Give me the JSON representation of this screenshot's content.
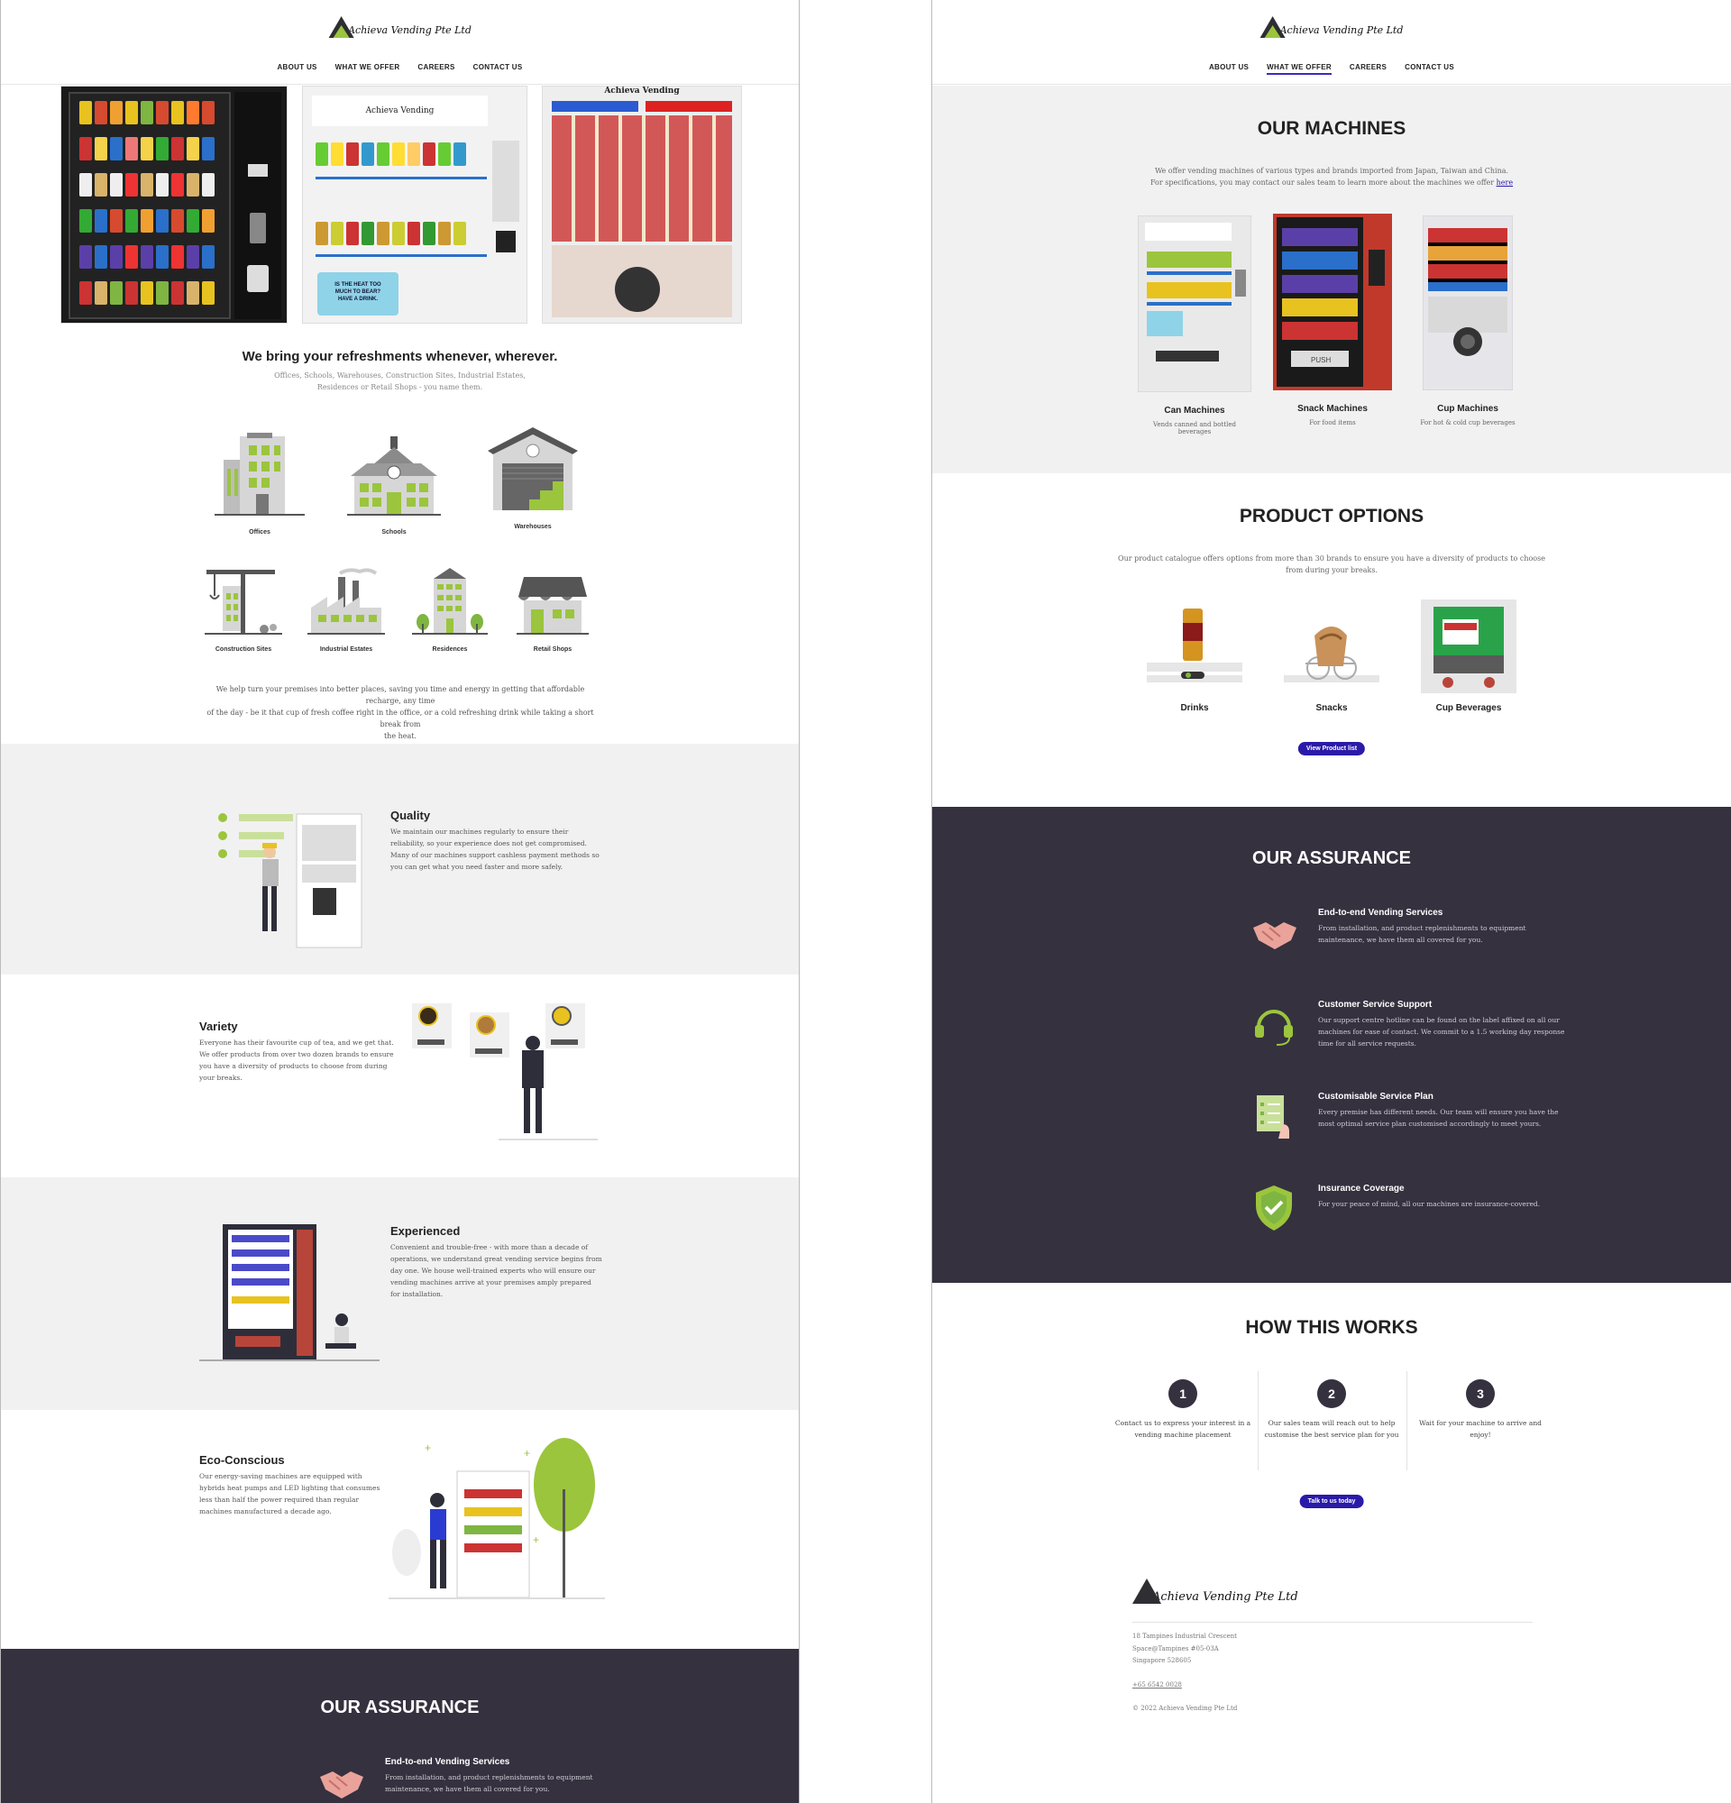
{
  "brand": {
    "logo_text": "Achieva Vending Pte Ltd",
    "accent": "#9bc53d",
    "dark": "#35313f",
    "button": "#2a1aa8"
  },
  "nav": {
    "about": "ABOUT US",
    "offer": "WHAT WE OFFER",
    "careers": "CAREERS",
    "contact": "CONTACT US"
  },
  "home": {
    "hero_can_label": "Achieva Vending",
    "hero_cup_label": "Achieva Vending",
    "hero_can_sign": "IS THE HEAT TOO MUCH TO BEAR? HAVE A DRINK.",
    "tagline": "We bring your refreshments whenever, wherever.",
    "tagline_sub_1": "Offices, Schools, Warehouses, Construction Sites, Industrial Estates,",
    "tagline_sub_2": "Residences or Retail Shops - you name them.",
    "locations": [
      "Offices",
      "Schools",
      "Warehouses",
      "Construction Sites",
      "Industrial Estates",
      "Residences",
      "Retail Shops"
    ],
    "intro_1": "We help turn your premises into better places, saving you time and energy in getting that affordable recharge, any time",
    "intro_2": "of the day - be it that cup of fresh coffee right in the office, or a cold refreshing drink while taking a short break from",
    "intro_3": "the heat.",
    "features": [
      {
        "title": "Quality",
        "text": "We maintain our machines regularly to ensure their reliability, so your experience does not get compromised. Many of our machines support cashless payment methods so you can get what you need faster and more safely."
      },
      {
        "title": "Variety",
        "text": "Everyone has their favourite cup of tea, and we get that. We offer products from over two dozen brands to ensure you have a diversity of products to choose from during your breaks."
      },
      {
        "title": "Experienced",
        "text": "Convenient and trouble-free - with more than a decade of operations, we understand great vending service begins from day one. We house well-trained experts who will ensure our vending machines arrive at your premises amply prepared for installation."
      },
      {
        "title": "Eco-Conscious",
        "text": "Our energy-saving machines are equipped with hybrids heat pumps and LED lighting that consumes less than half the power required than regular machines manufactured a decade ago."
      }
    ],
    "assurance_title": "OUR ASSURANCE",
    "assurance_first_title": "End-to-end Vending Services",
    "assurance_first_text": "From installation, and product replenishments to equipment maintenance, we have them all covered for you."
  },
  "offer": {
    "machines_title": "OUR MACHINES",
    "machines_sub_1": "We offer vending machines of various types and brands imported from Japan, Taiwan and China.",
    "machines_sub_2": "For specifications, you may contact our sales team to learn more about the machines we offer",
    "machines_link": "here",
    "machines": [
      {
        "name": "Can Machines",
        "desc": "Vends canned and bottled beverages"
      },
      {
        "name": "Snack Machines",
        "desc": "For food items"
      },
      {
        "name": "Cup Machines",
        "desc": "For hot & cold cup beverages"
      }
    ],
    "snack_push": "PUSH",
    "products_title": "PRODUCT OPTIONS",
    "products_sub_1": "Our product catalogue offers options from more than 30 brands to ensure you have a diversity of products to choose",
    "products_sub_2": "from during your breaks.",
    "products": [
      "Drinks",
      "Snacks",
      "Cup Beverages"
    ],
    "product_list_btn": "View Product list",
    "assurance_title": "OUR ASSURANCE",
    "assurance": [
      {
        "title": "End-to-end Vending Services",
        "text": "From installation, and product replenishments to equipment maintenance, we have them all covered for you."
      },
      {
        "title": "Customer Service Support",
        "text": "Our support centre hotline can be found on the label affixed on all our machines for ease of contact. We commit to a 1.5 working day response time for all service requests."
      },
      {
        "title": "Customisable Service Plan",
        "text": "Every premise has different needs. Our team will ensure you have the most optimal service plan customised accordingly to meet yours."
      },
      {
        "title": "Insurance Coverage",
        "text": "For your peace of mind, all our machines are insurance-covered."
      }
    ],
    "how_title": "HOW THIS WORKS",
    "steps": [
      {
        "num": "1",
        "text": "Contact us to express your interest in a vending machine placement"
      },
      {
        "num": "2",
        "text": "Our sales team will reach out to help customise the best service plan for you"
      },
      {
        "num": "3",
        "text": "Wait for your machine to arrive and enjoy!"
      }
    ],
    "talk_btn": "Talk to us today",
    "footer": {
      "addr1": "18 Tampines Industrial Crescent",
      "addr2": "Space@Tampines #05-03A",
      "addr3": "Singapore 528605",
      "phone": "+65 6542 0028",
      "copyright": "© 2022 Achieva Vending Pte Ltd"
    }
  }
}
